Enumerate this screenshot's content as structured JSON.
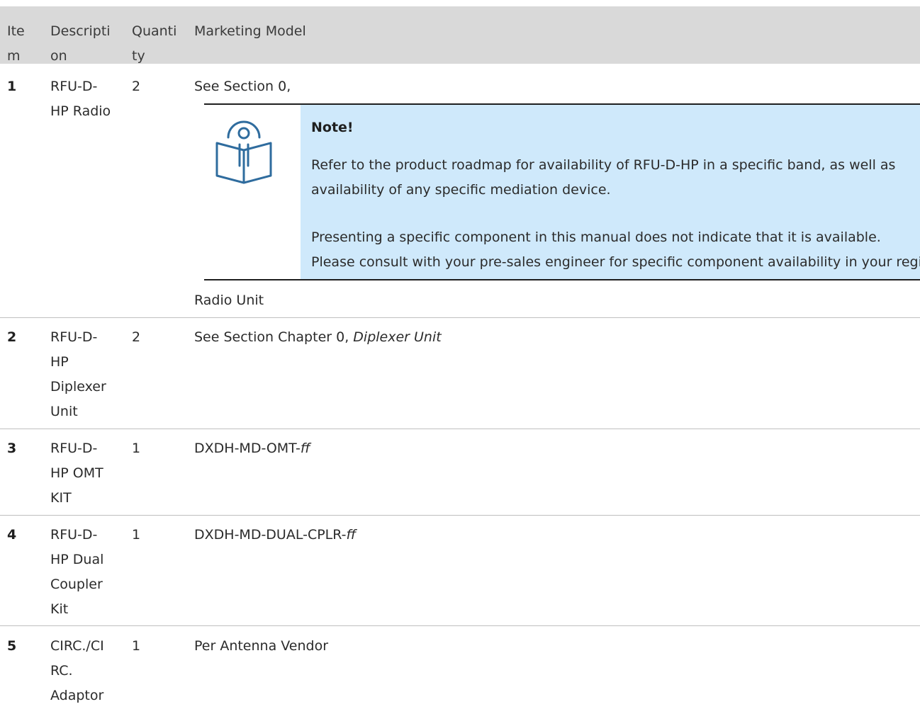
{
  "table": {
    "headers": {
      "item": [
        "Ite",
        "m"
      ],
      "description": [
        "Descripti",
        "on"
      ],
      "quantity": [
        "Quanti",
        "ty"
      ],
      "marketing_model": "Marketing Model"
    },
    "rows": [
      {
        "item": "1",
        "description": [
          "RFU-D-",
          "HP Radio"
        ],
        "quantity": "2",
        "model": "See Section 0,",
        "model_suffix": "Radio Unit"
      },
      {
        "item": "2",
        "description": [
          "RFU-D-",
          "HP",
          "Diplexer",
          "Unit"
        ],
        "quantity": "2",
        "model": "See Section Chapter 0, ",
        "model_italic": "Diplexer Unit"
      },
      {
        "item": "3",
        "description": [
          "RFU-D-",
          "HP OMT",
          "KIT"
        ],
        "quantity": "1",
        "model": "DXDH-MD-OMT-",
        "model_italic": "ff"
      },
      {
        "item": "4",
        "description": [
          "RFU-D-",
          "HP Dual",
          "Coupler",
          "Kit"
        ],
        "quantity": "1",
        "model": "DXDH-MD-DUAL-CPLR-",
        "model_italic": "ff"
      },
      {
        "item": "5",
        "description": [
          "CIRC./CI",
          "RC.",
          "Adaptor"
        ],
        "quantity": "1",
        "model": "Per Antenna Vendor"
      }
    ]
  },
  "note": {
    "icon": "book-reader-icon",
    "title": "Note!",
    "lines": [
      "Refer to the product roadmap for availability of RFU-D-HP in a specific band, as well as",
      "availability of any specific mediation device.",
      "Presenting a specific component in this manual does not indicate that it is available.",
      "Please consult with your pre-sales engineer for specific component availability in your region."
    ],
    "background_color": "#cfe9fb"
  }
}
